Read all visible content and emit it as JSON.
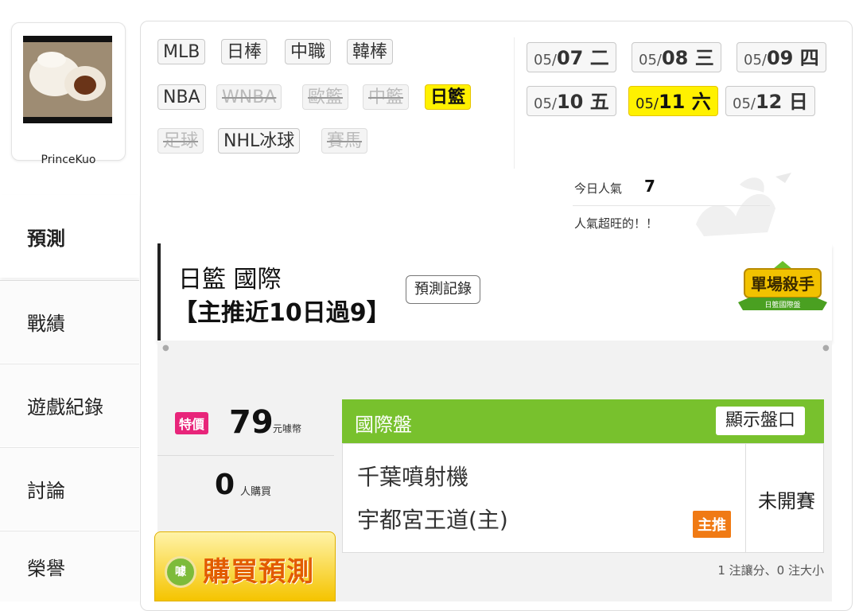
{
  "user": {
    "name": "PrinceKuo"
  },
  "sidebar": {
    "items": [
      {
        "label": "預測"
      },
      {
        "label": "戰績"
      },
      {
        "label": "遊戲紀錄"
      },
      {
        "label": "討論"
      },
      {
        "label": "榮譽"
      }
    ]
  },
  "leagues": {
    "row1": [
      "MLB",
      "日棒",
      "中職",
      "韓棒"
    ],
    "row2": [
      "NBA",
      "WNBA",
      "歐籃",
      "中籃",
      "日籃"
    ],
    "row3": [
      "足球",
      "NHL冰球",
      "賽馬"
    ]
  },
  "dates": [
    {
      "prefix": "05/",
      "day": "07 二"
    },
    {
      "prefix": "05/",
      "day": "08 三"
    },
    {
      "prefix": "05/",
      "day": "09 四"
    },
    {
      "prefix": "05/",
      "day": "10 五"
    },
    {
      "prefix": "05/",
      "day": "11 六"
    },
    {
      "prefix": "05/",
      "day": "12 日"
    }
  ],
  "popularity": {
    "label": "今日人氣",
    "count": "7",
    "message": "人氣超旺的！！"
  },
  "prediction": {
    "title": "日籃 國際",
    "subtitle": "【主推近10日過9】",
    "record_button": "預測記錄",
    "badge_main": "單場殺手",
    "badge_sub": "日籃國際盤"
  },
  "price": {
    "tag": "特價",
    "value": "79",
    "unit": "元噱幣"
  },
  "buyers": {
    "value": "0",
    "unit": "人購買"
  },
  "buy_button": {
    "icon_text": "噱",
    "label": "購買預測"
  },
  "game": {
    "market": "國際盤",
    "show_odds": "顯示盤口",
    "away": "千葉噴射機",
    "home": "宇都宮王道(主)",
    "pick_label": "主推",
    "status": "未開賽"
  },
  "bet_summary": "1 注讓分、0 注大小",
  "colors": {
    "active_yellow": "#fff100",
    "market_green": "#78c12d",
    "special_pink": "#e8257a",
    "pick_orange": "#f07a14"
  }
}
